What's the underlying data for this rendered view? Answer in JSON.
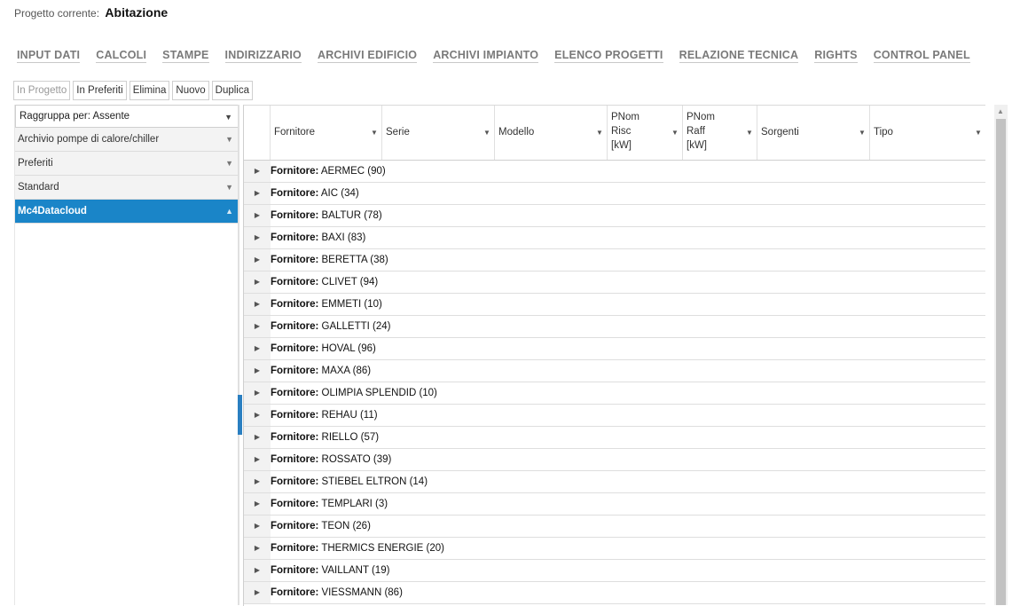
{
  "project": {
    "label": "Progetto corrente:",
    "name": "Abitazione"
  },
  "menu": [
    "INPUT DATI",
    "CALCOLI",
    "STAMPE",
    "INDIRIZZARIO",
    "ARCHIVI EDIFICIO",
    "ARCHIVI IMPIANTO",
    "ELENCO PROGETTI",
    "RELAZIONE TECNICA",
    "RIGHTS",
    "CONTROL PANEL"
  ],
  "actions": {
    "in_progetto": "In Progetto",
    "in_preferiti": "In Preferiti",
    "elimina": "Elimina",
    "nuovo": "Nuovo",
    "duplica": "Duplica"
  },
  "left": {
    "group_by": "Raggruppa per:  Assente",
    "items": [
      "Archivio pompe di calore/chiller",
      "Preferiti",
      "Standard",
      "Mc4Datacloud"
    ],
    "active_index": 3
  },
  "grid": {
    "columns": [
      "Fornitore",
      "Serie",
      "Modello",
      "PNom Risc [kW]",
      "PNom Raff [kW]",
      "Sorgenti",
      "Tipo"
    ],
    "col_lines": {
      "pnom_risc": [
        "PNom",
        "Risc",
        "[kW]"
      ],
      "pnom_raff": [
        "PNom",
        "Raff",
        "[kW]"
      ]
    },
    "group_prefix": "Fornitore:",
    "groups": [
      "AERMEC (90)",
      "AIC (34)",
      "BALTUR (78)",
      "BAXI (83)",
      "BERETTA (38)",
      "CLIVET (94)",
      "EMMETI (10)",
      "GALLETTI (24)",
      "HOVAL (96)",
      "MAXA (86)",
      "OLIMPIA SPLENDID (10)",
      "REHAU (11)",
      "RIELLO (57)",
      "ROSSATO (39)",
      "STIEBEL ELTRON (14)",
      "TEMPLARI (3)",
      "TEON (26)",
      "THERMICS ENERGIE (20)",
      "VAILLANT (19)",
      "VIESSMANN (86)"
    ]
  },
  "colors": {
    "accent": "#1a85c8"
  }
}
